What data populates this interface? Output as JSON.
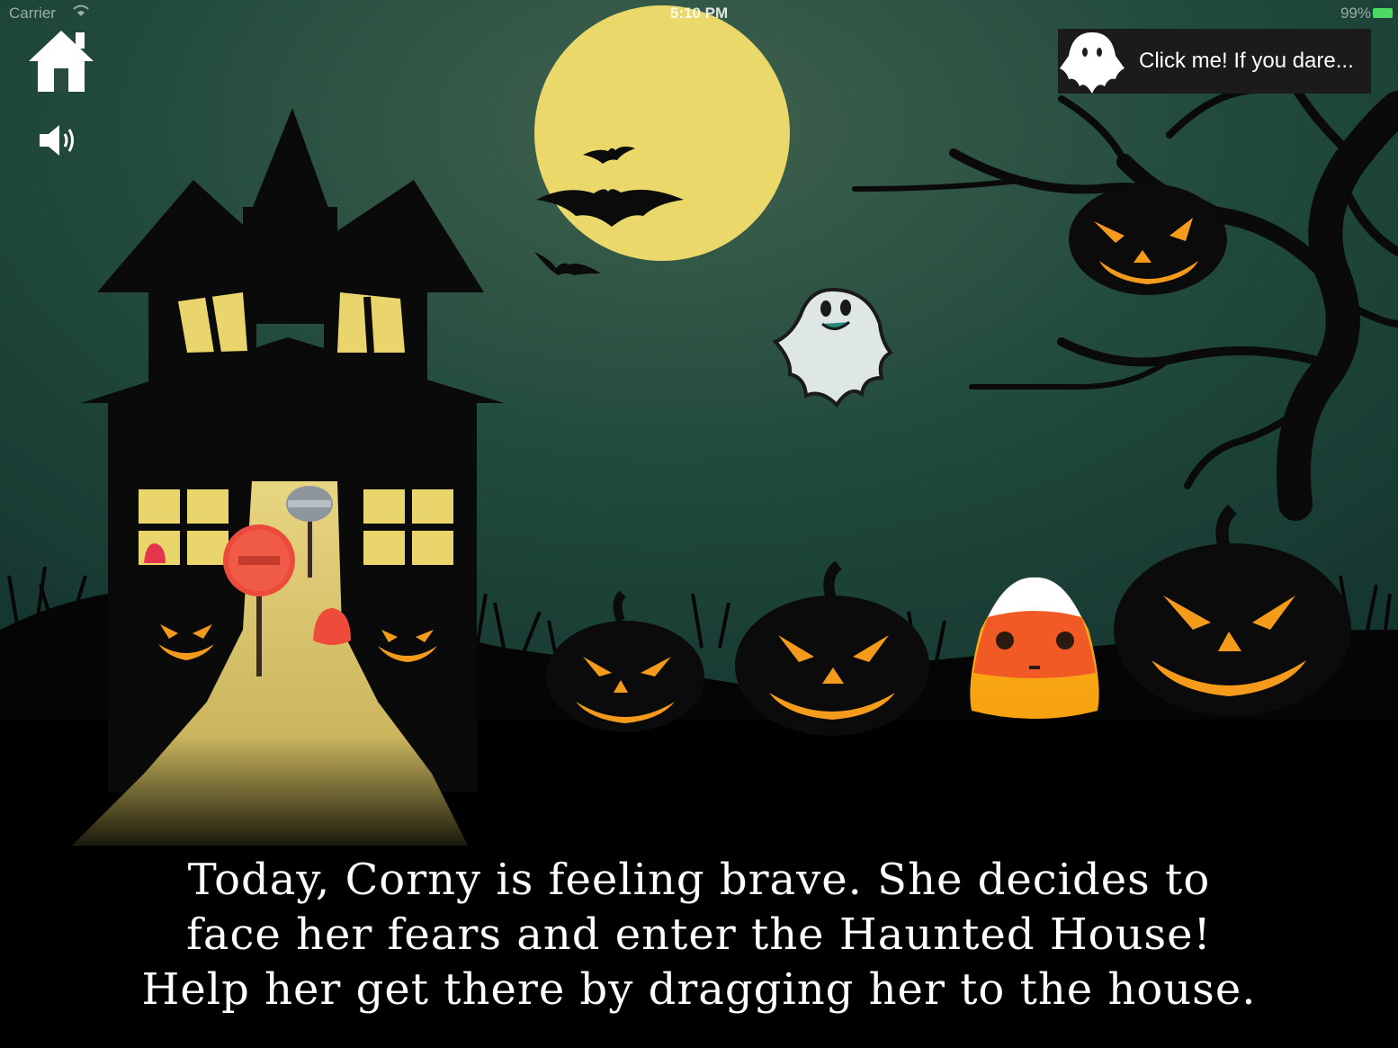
{
  "status_bar": {
    "carrier": "Carrier",
    "time": "5:10 PM",
    "battery": "99%"
  },
  "toolbar": {
    "home_icon": "home-icon",
    "sound_icon": "speaker-icon"
  },
  "ghost_button": {
    "label": "Click me! If you dare...",
    "icon": "ghost-icon"
  },
  "story": {
    "lines": [
      "Today, Corny is feeling brave. She decides to",
      "face her fears and enter the Haunted House!",
      "Help her get there by dragging her to the house."
    ]
  },
  "colors": {
    "sky_top": "#1f3d30",
    "sky_bottom": "#163a36",
    "moon": "#ead96a",
    "window_light": "#e9d56b",
    "pumpkin_glow": "#f59b1c",
    "candy_orange": "#f15a24",
    "candy_yellow": "#fbb01a",
    "status_battery": "#4cd964"
  }
}
